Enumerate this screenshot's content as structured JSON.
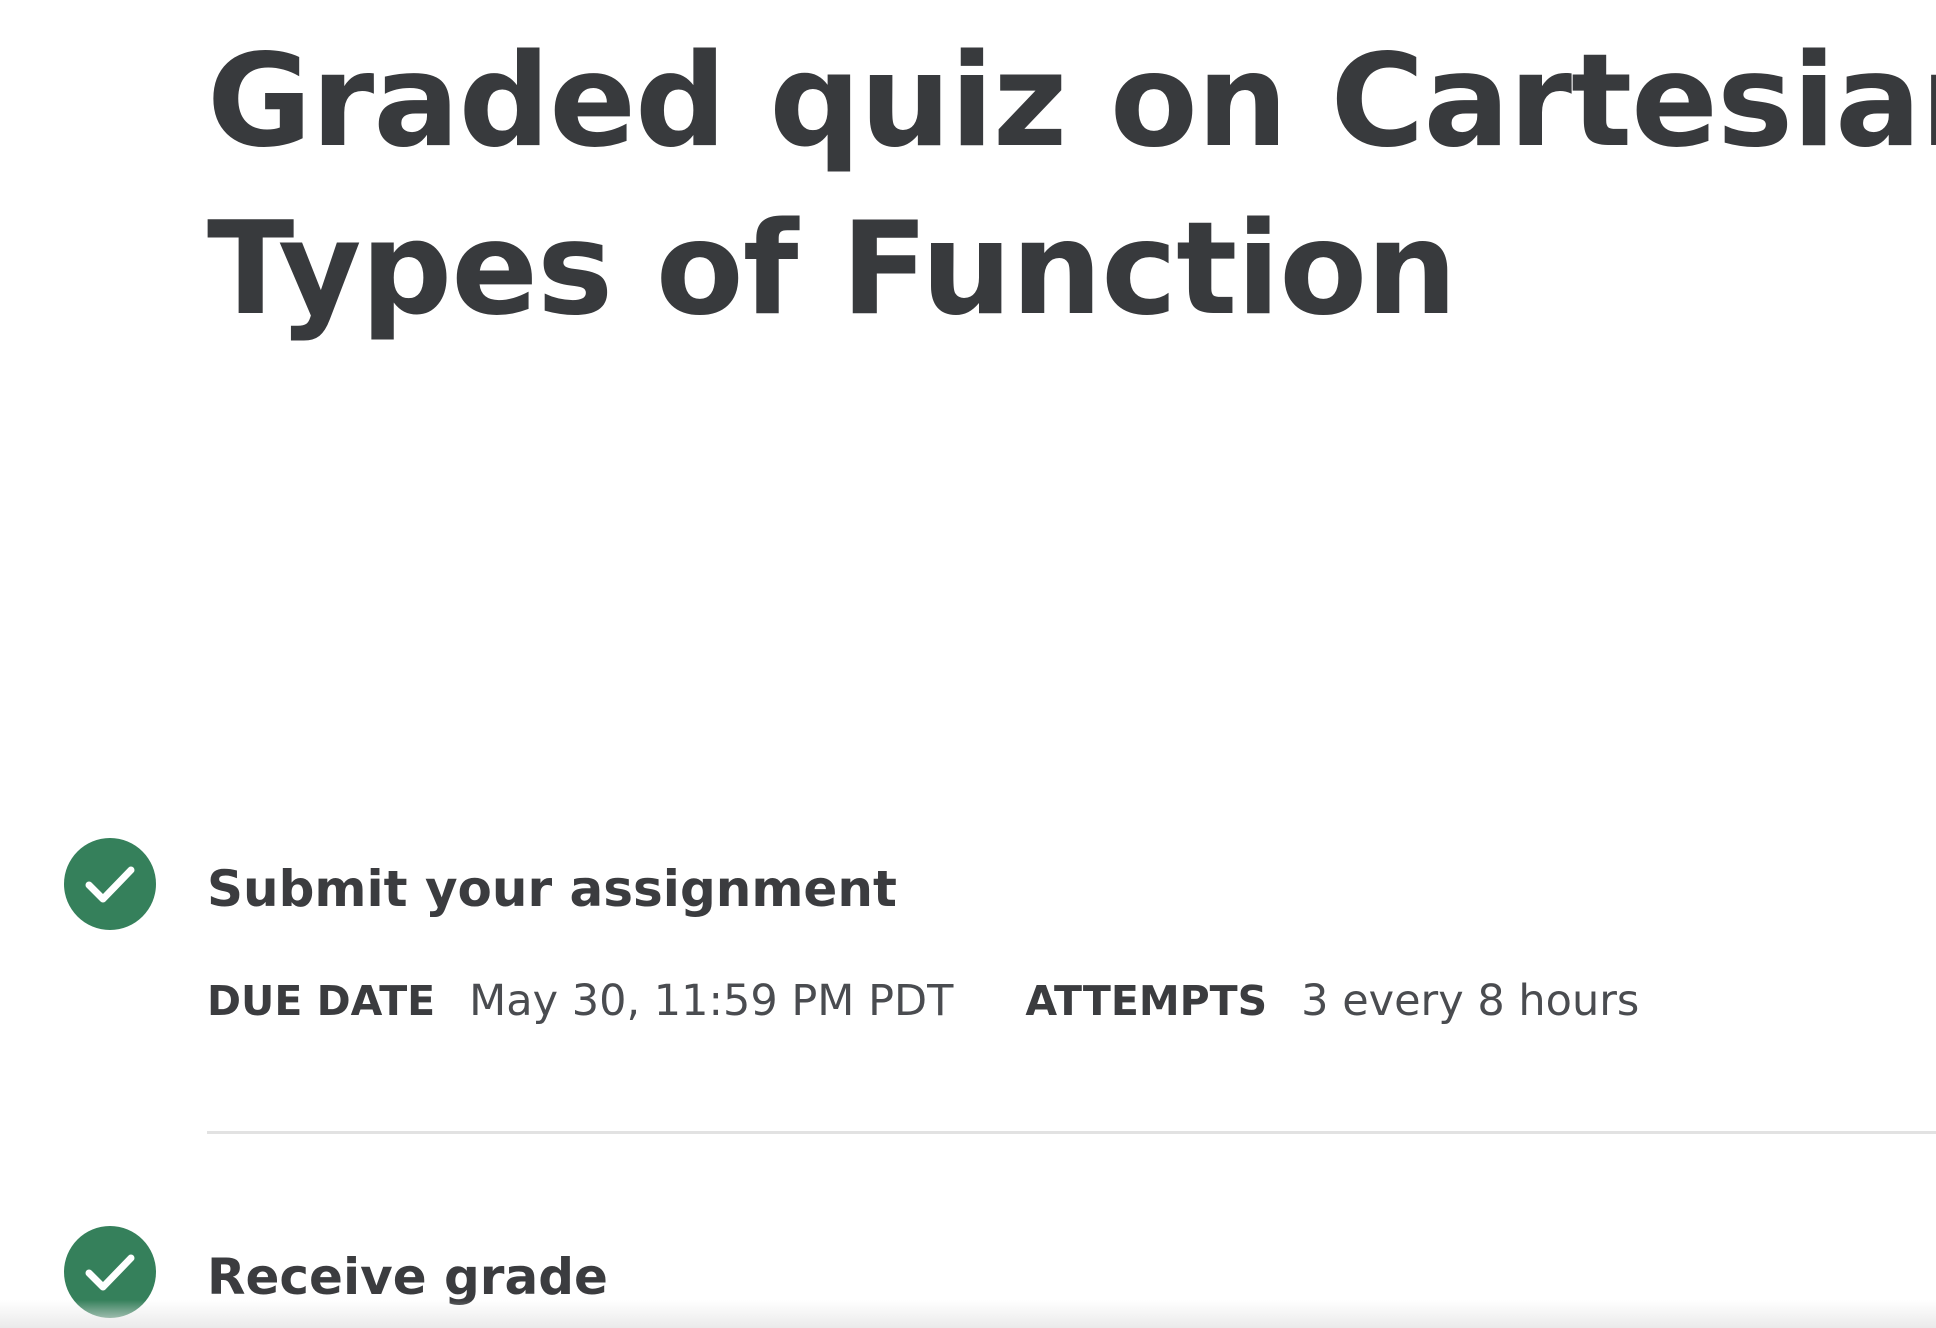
{
  "page": {
    "title_lines": [
      "Graded quiz on Cartesian",
      "Types of Function"
    ]
  },
  "steps": [
    {
      "title": "Submit your assignment",
      "icon": "check-icon",
      "status": "complete",
      "meta": [
        {
          "label": "DUE DATE",
          "value": "May 30, 11:59 PM PDT"
        },
        {
          "label": "ATTEMPTS",
          "value": "3 every 8 hours"
        }
      ]
    },
    {
      "title": "Receive grade",
      "icon": "check-icon",
      "status": "complete"
    }
  ],
  "colors": {
    "success_green": "#35805b",
    "heading_text": "#383a3d",
    "divider": "#e2e2e2"
  }
}
